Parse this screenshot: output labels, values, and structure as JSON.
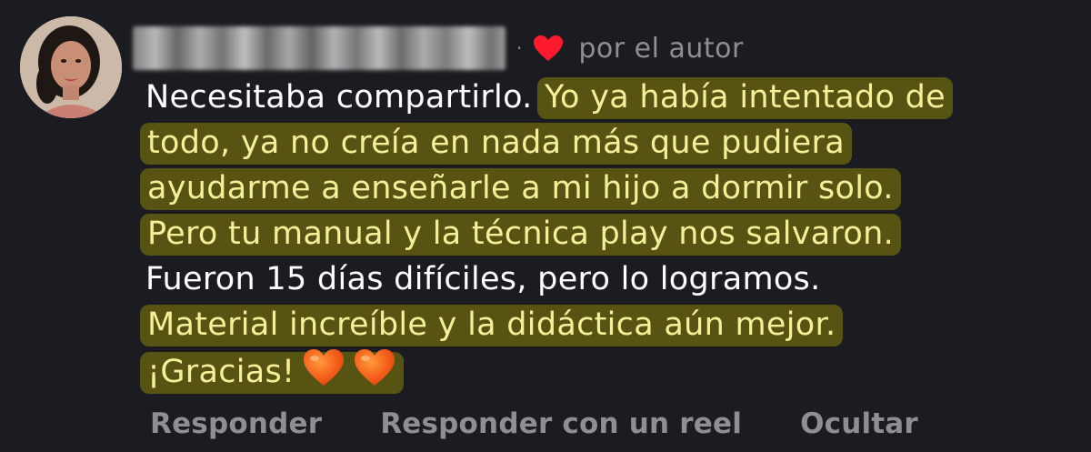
{
  "comment": {
    "avatar_icon": "profile-photo",
    "username_redacted": true,
    "separator": "·",
    "author_like_icon": "red-heart-icon",
    "author_like_label": "por el autor",
    "lines": [
      {
        "plain": "Necesitaba compartirlo. ",
        "highlight": "Yo ya había intentado de"
      },
      {
        "plain": "",
        "highlight": "todo, ya no creía en nada más que pudiera"
      },
      {
        "plain": "",
        "highlight": "ayudarme a enseñarle a mi hijo a dormir solo."
      },
      {
        "plain": "",
        "highlight": "Pero tu manual y la técnica play nos salvaron."
      },
      {
        "plain": "Fueron 15 días difíciles, pero lo logramos.",
        "highlight": ""
      },
      {
        "plain": "",
        "highlight": "Material increíble y la didáctica aún mejor."
      },
      {
        "plain": "",
        "highlight": "¡Gracias!"
      }
    ],
    "emoji": "orange-heart-emoji",
    "highlight_color": "#aaa000",
    "highlight_text_color": "#f6ef9a"
  },
  "actions": {
    "reply": "Responder",
    "reply_reel": "Responder con un reel",
    "hide": "Ocultar"
  }
}
